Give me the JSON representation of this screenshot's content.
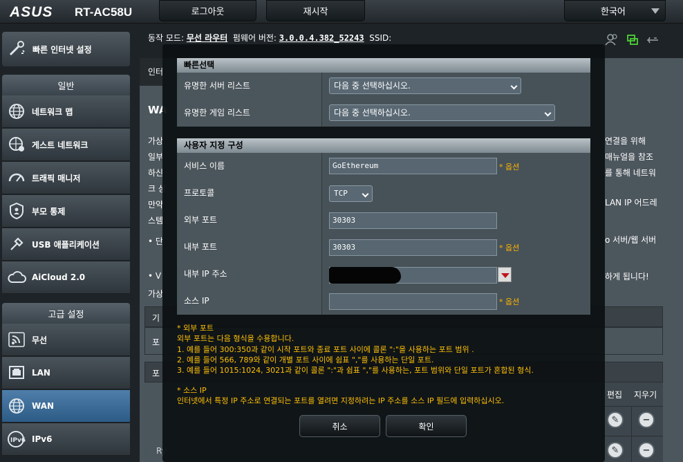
{
  "header": {
    "brand": "ASUS",
    "model": "RT-AC58U",
    "logout": "로그아웃",
    "reboot": "재시작",
    "language": "한국어"
  },
  "status": {
    "op_mode_label": "동작 모드:",
    "op_mode_value": "무선 라우터",
    "firmware_label": "펌웨어 버전:",
    "firmware_value": "3.0.0.4.382_52243",
    "ssid_label": "SSID:"
  },
  "sidebar": {
    "quick_setup": "빠른 인터넷 설정",
    "general_header": "일반",
    "general_items": [
      {
        "label": "네트워크 맵",
        "icon": "globe-icon"
      },
      {
        "label": "게스트 네트워크",
        "icon": "guest-network-icon"
      },
      {
        "label": "트래픽 매니저",
        "icon": "gauge-icon"
      },
      {
        "label": "부모 통제",
        "icon": "shield-icon"
      },
      {
        "label": "USB 애플리케이션",
        "icon": "usb-icon"
      },
      {
        "label": "AiCloud 2.0",
        "icon": "cloud-icon"
      }
    ],
    "advanced_header": "고급 설정",
    "advanced_items": [
      {
        "label": "무선",
        "icon": "wifi-icon"
      },
      {
        "label": "LAN",
        "icon": "lan-icon"
      },
      {
        "label": "WAN",
        "icon": "wan-globe-icon",
        "active": true
      },
      {
        "label": "IPv6",
        "icon": "ipv6-icon"
      }
    ]
  },
  "background": {
    "tab_label": "인터",
    "title": "WA",
    "right_lines": [
      "연결을 위해",
      "매뉴얼을 참조",
      "를 통해 네트워",
      "",
      "LAN IP 어드레",
      "",
      "",
      "o 서버/웹 서버",
      "",
      "하게 됩니다!"
    ],
    "left_frags": [
      "가상",
      "일부",
      "하신",
      "크 상",
      "만약",
      "스템",
      "• 단",
      "",
      "• V",
      "가상"
    ],
    "table_headers": [
      "편집",
      "지우기"
    ],
    "row_frag": "Ry",
    "box_frag": "기",
    "box_frag2": "포",
    "box_frag3": "포"
  },
  "dialog": {
    "quick_select": {
      "header": "빠른선택",
      "server_label": "유명한 서버 리스트",
      "server_value": "다음 중 선택하십시오.",
      "game_label": "유명한 게임 리스트",
      "game_value": "다음 중 선택하십시오."
    },
    "custom": {
      "header": "사용자 지정 구성",
      "service_label": "서비스 이름",
      "service_value": "GoEthereum",
      "protocol_label": "프로토콜",
      "protocol_value": "TCP",
      "ext_port_label": "외부 포트",
      "ext_port_value": "30303",
      "int_port_label": "내부 포트",
      "int_port_value": "30303",
      "int_ip_label": "내부 IP 주소",
      "src_ip_label": "소스 IP",
      "src_ip_value": "",
      "optional": "* 옵션"
    },
    "notes": [
      "* 외부 포트",
      "외부 포트는 다음 형식을 수용합니다.",
      "1. 예를 들어 300:350과 같이 시작 포트와 종료 포트 사이에 콜론 \":\"을 사용하는 포트 범위 .",
      "2. 예를 들어 566, 789와 같이 개별 포트 사이에 쉼표 \",\"를 사용하는 단일 포트.",
      "3. 예를 들어 1015:1024, 3021과 같이 콜론 \":\"과 쉼표 \",\"를 사용하는, 포트 범위와 단일 포트가 혼합된 형식.",
      "* 소스 IP",
      "인터넷에서 특정 IP 주소로 연결되는 포트를 열려면 지정하려는 IP 주소를 소스 IP 필드에 입력하십시오."
    ],
    "cancel": "취소",
    "ok": "확인"
  }
}
